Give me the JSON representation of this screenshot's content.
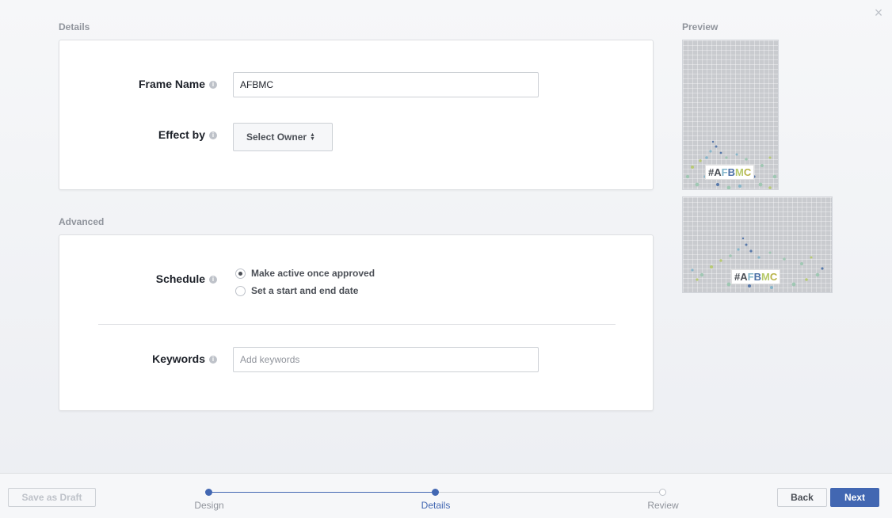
{
  "dialog": {
    "close_symbol": "×"
  },
  "details": {
    "heading": "Details",
    "frame_name_label": "Frame Name",
    "frame_name_value": "AFBMC",
    "effect_by_label": "Effect by",
    "select_owner_label": "Select Owner"
  },
  "advanced": {
    "heading": "Advanced",
    "schedule_label": "Schedule",
    "schedule_options": [
      {
        "label": "Make active once approved",
        "selected": true
      },
      {
        "label": "Set a start and end date",
        "selected": false
      }
    ],
    "keywords_label": "Keywords",
    "keywords_placeholder": "Add keywords",
    "keywords_value": ""
  },
  "preview": {
    "heading": "Preview",
    "tag_text": "#AFBMC",
    "tag_letters": [
      {
        "ch": "#",
        "color": "#4b4f56"
      },
      {
        "ch": "A",
        "color": "#4b4f56"
      },
      {
        "ch": "F",
        "color": "#7fb3c9"
      },
      {
        "ch": "B",
        "color": "#4a6fa5"
      },
      {
        "ch": "M",
        "color": "#b6c96a"
      },
      {
        "ch": "C",
        "color": "#b9b44a"
      }
    ]
  },
  "footer": {
    "save_draft_label": "Save as Draft",
    "back_label": "Back",
    "next_label": "Next",
    "steps": [
      {
        "label": "Design",
        "state": "done"
      },
      {
        "label": "Details",
        "state": "current"
      },
      {
        "label": "Review",
        "state": "pending"
      }
    ]
  },
  "colors": {
    "accent": "#4267b2",
    "muted": "#90949c",
    "border": "#dddfe2"
  },
  "icons": {
    "info": "info-icon",
    "close": "close-icon",
    "updown": "updown-arrows-icon"
  }
}
